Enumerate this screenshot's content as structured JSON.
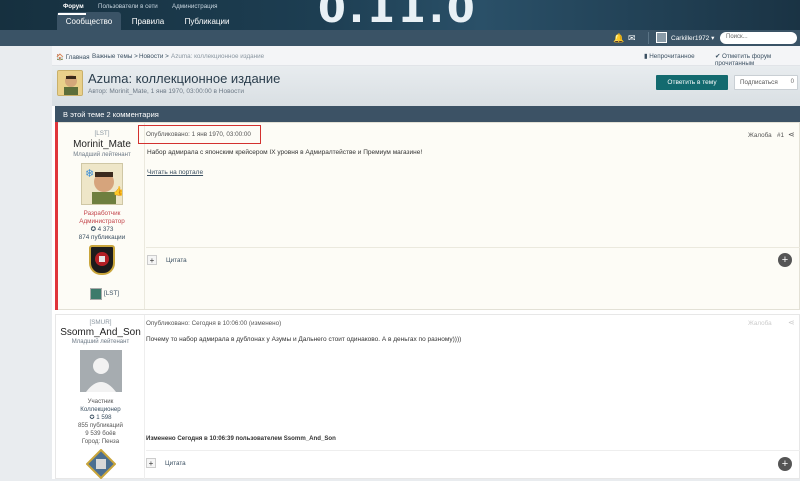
{
  "header": {
    "banner_text": "0.11.0",
    "tabs": [
      "Сообщество",
      "Правила",
      "Публикации"
    ],
    "subnav": [
      "Форум",
      "Пользователи в сети",
      "Администрация"
    ],
    "user_name": "Carkiller1972 ▾",
    "search_placeholder": "Поиск..."
  },
  "breadcrumb": {
    "home": "🏠 Главная",
    "important": "Важные темы",
    "news": "Новости",
    "current": "Azuma: коллекционное издание",
    "sep": ">"
  },
  "actions": {
    "unread": "▮ Непрочитанное",
    "mark_read": "✔ Отметить форум прочитанным"
  },
  "topic": {
    "title": "Azuma: коллекционное издание",
    "meta": "Автор: Morinit_Mate, 1 янв 1970, 03:00:00 в Новости",
    "reply_label": "Ответить в тему",
    "follow_label": "Подписаться",
    "follow_count": "0",
    "comments_bar": "В этой теме 2 комментария"
  },
  "posts": [
    {
      "clan": "[LST]",
      "author": "Morinit_Mate",
      "rank": "Младший лейтенант",
      "role1": "Разработчик",
      "role2": "Администратор",
      "reputation": "✪ 4 373",
      "publications": "874 публикации",
      "clan_tag": "[LST]",
      "date": "Опубликовано: 1 янв 1970, 03:00:00",
      "report": "Жалоба",
      "number": "#1",
      "text": "Набор адмирала с японским крейсером IX уровня в Адмиралтействе и Премиум магазине!",
      "link": "Читать на портале",
      "quote": "Цитата"
    },
    {
      "clan": "[SMUR]",
      "author": "Ssomm_And_Son",
      "rank": "Младший лейтенант",
      "group": "Участник",
      "role": "Коллекционер",
      "reputation": "✪ 1 598",
      "publications": "855 публикаций",
      "battles": "9 539 боёв",
      "city": "Город: Пенза",
      "date": "Опубликовано: Сегодня в 10:06:00 (изменено)",
      "report": "Жалоба",
      "text": "Почему то набор адмирала в дублонах у Азумы и Дальнего стоит одинаково. А в деньгах по разному))))",
      "edited": "Изменено Сегодня в 10:06:39 пользователем Ssomm_And_Son",
      "quote": "Цитата"
    }
  ],
  "colors": {
    "header": "#1d3e52",
    "subnav": "#3a5366",
    "accent_button": "#136a6f",
    "highlight_stripe": "#e0353b",
    "highlight_box": "#d3312f"
  }
}
